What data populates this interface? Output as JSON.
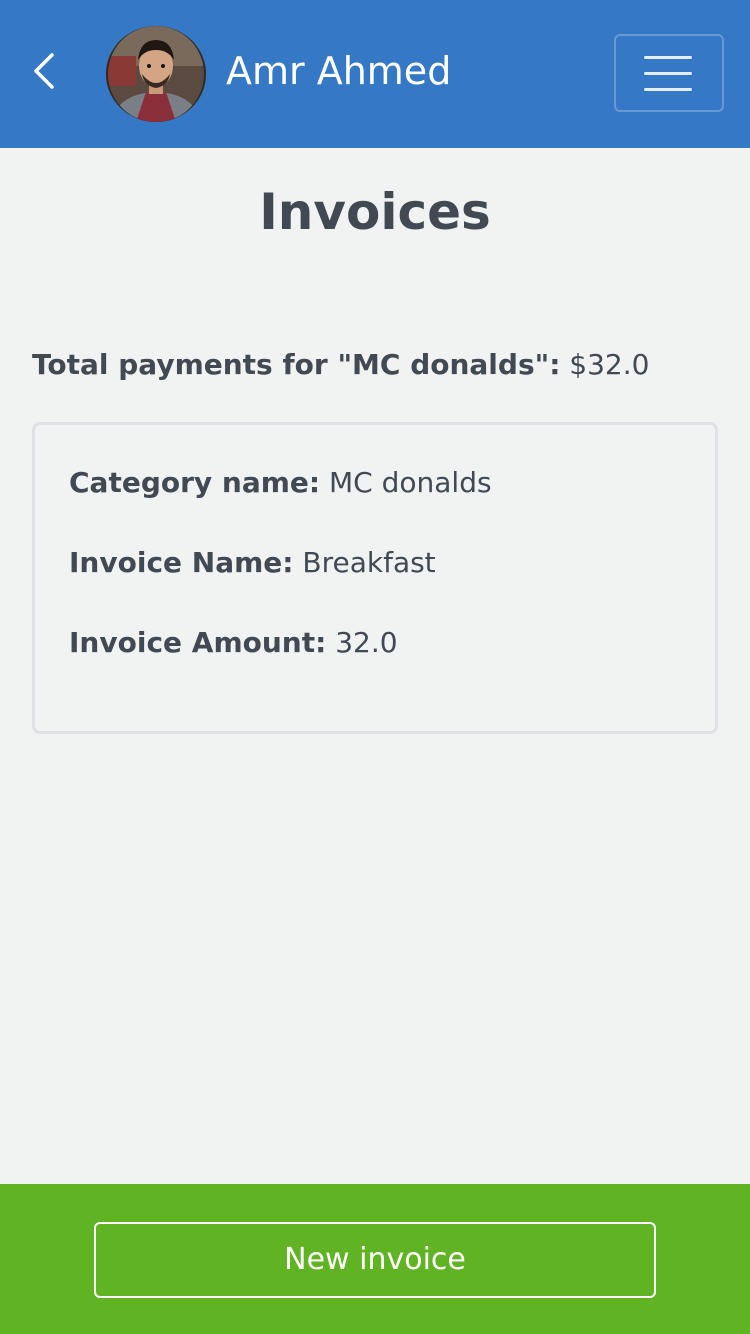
{
  "header": {
    "user_name": "Amr Ahmed",
    "back_icon": "chevron-left-icon",
    "menu_icon": "hamburger-menu-icon",
    "background_color": "#3578c5"
  },
  "main": {
    "title": "Invoices",
    "total": {
      "label": "Total payments for \"MC donalds\":",
      "value": "$32.0"
    },
    "invoice": {
      "category_label": "Category name:",
      "category_value": "MC donalds",
      "name_label": "Invoice Name:",
      "name_value": "Breakfast",
      "amount_label": "Invoice Amount:",
      "amount_value": "32.0"
    }
  },
  "footer": {
    "new_invoice_label": "New invoice",
    "background_color": "#60b322"
  }
}
